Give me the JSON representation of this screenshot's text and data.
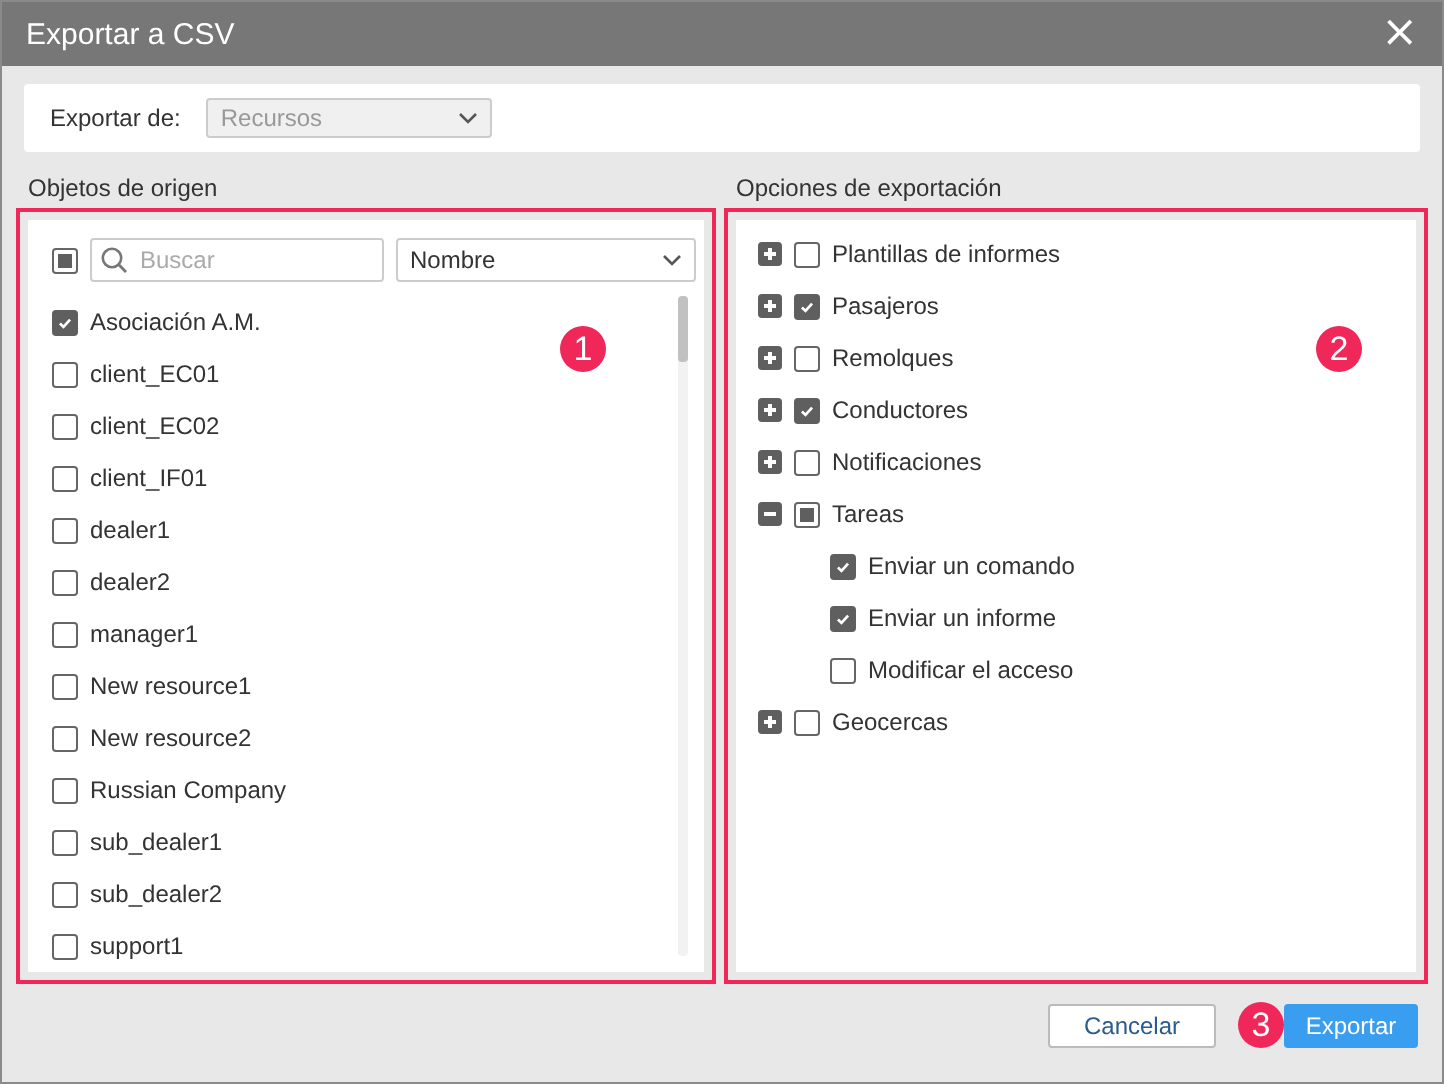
{
  "window": {
    "title": "Exportar a CSV",
    "close": "×"
  },
  "export_from": {
    "label": "Exportar de:",
    "value": "Recursos",
    "disabled": true
  },
  "source": {
    "title": "Objetos de origen",
    "select_all": {
      "checked": false,
      "partial": true
    },
    "search": {
      "placeholder": "Buscar"
    },
    "sort": {
      "value": "Nombre"
    },
    "items": [
      {
        "label": "Asociación A.M.",
        "checked": true
      },
      {
        "label": "client_EC01",
        "checked": false
      },
      {
        "label": "client_EC02",
        "checked": false
      },
      {
        "label": "client_IF01",
        "checked": false
      },
      {
        "label": "dealer1",
        "checked": false
      },
      {
        "label": "dealer2",
        "checked": false
      },
      {
        "label": "manager1",
        "checked": false
      },
      {
        "label": "New resource1",
        "checked": false
      },
      {
        "label": "New resource2",
        "checked": false
      },
      {
        "label": "Russian Company",
        "checked": false
      },
      {
        "label": "sub_dealer1",
        "checked": false
      },
      {
        "label": "sub_dealer2",
        "checked": false
      },
      {
        "label": "support1",
        "checked": false
      }
    ]
  },
  "options": {
    "title": "Opciones de exportación",
    "items": [
      {
        "label": "Plantillas de informes",
        "checked": false,
        "expanded": false
      },
      {
        "label": "Pasajeros",
        "checked": true,
        "expanded": false
      },
      {
        "label": "Remolques",
        "checked": false,
        "expanded": false
      },
      {
        "label": "Conductores",
        "checked": true,
        "expanded": false
      },
      {
        "label": "Notificaciones",
        "checked": false,
        "expanded": false
      },
      {
        "label": "Tareas",
        "checked": false,
        "partial": true,
        "expanded": true,
        "children": [
          {
            "label": "Enviar un comando",
            "checked": true
          },
          {
            "label": "Enviar un informe",
            "checked": true
          },
          {
            "label": "Modificar el acceso",
            "checked": false
          }
        ]
      },
      {
        "label": "Geocercas",
        "checked": false,
        "expanded": false
      }
    ]
  },
  "buttons": [
    {
      "label": "Cancelar",
      "kind": "secondary"
    },
    {
      "label": "Exportar",
      "kind": "primary",
      "badge": "3"
    }
  ],
  "badges": {
    "source": "1",
    "options": "2"
  }
}
